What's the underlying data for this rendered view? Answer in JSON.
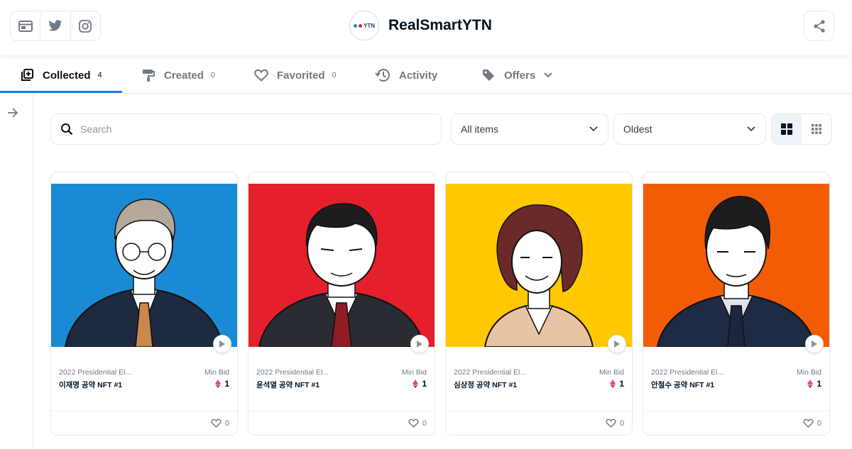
{
  "header": {
    "brand_name": "RealSmartYTN",
    "logo_text": "YTN",
    "social_icons": [
      "website-icon",
      "twitter-icon",
      "instagram-icon"
    ],
    "share_icon": "share-icon"
  },
  "tabs": [
    {
      "label": "Collected",
      "count": "4",
      "icon": "collected-icon",
      "active": true
    },
    {
      "label": "Created",
      "count": "0",
      "icon": "paintbrush-icon"
    },
    {
      "label": "Favorited",
      "count": "0",
      "icon": "heart-icon"
    },
    {
      "label": "Activity",
      "count": "",
      "icon": "history-icon"
    },
    {
      "label": "Offers",
      "count": "",
      "icon": "tag-icon"
    }
  ],
  "toolbar": {
    "search_placeholder": "Search",
    "items_filter": "All items",
    "sort": "Oldest"
  },
  "colors": {
    "accent": "#2081e2",
    "card_bg": [
      "#1a8ad4",
      "#e51f2b",
      "#ffc800",
      "#f25c05"
    ]
  },
  "cards": [
    {
      "collection": "2022 Presidential El...",
      "name": "이재명 공약 NFT #1",
      "min_bid_label": "Min Bid",
      "price": "1",
      "likes": "0"
    },
    {
      "collection": "2022 Presidential El...",
      "name": "윤석열 공약 NFT #1",
      "min_bid_label": "Min Bid",
      "price": "1",
      "likes": "0"
    },
    {
      "collection": "2022 Presidential El...",
      "name": "심상정 공약 NFT #1",
      "min_bid_label": "Min Bid",
      "price": "1",
      "likes": "0"
    },
    {
      "collection": "2022 Presidential El...",
      "name": "안철수 공약 NFT #1",
      "min_bid_label": "Min Bid",
      "price": "1",
      "likes": "0"
    }
  ]
}
